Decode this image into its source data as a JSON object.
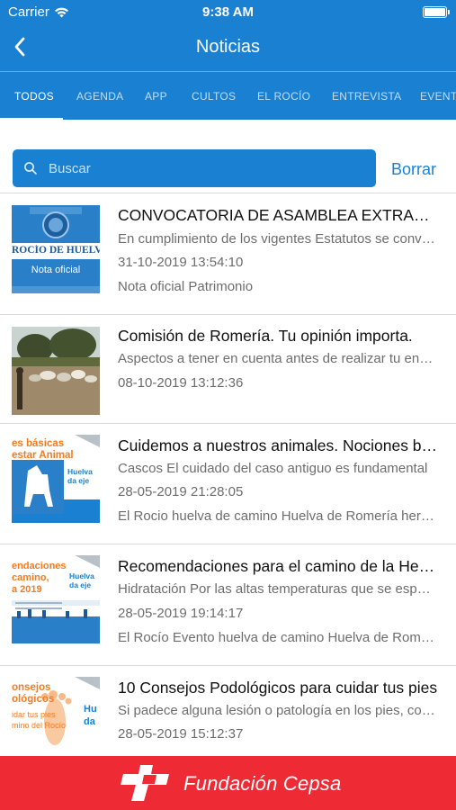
{
  "status_bar": {
    "carrier": "Carrier",
    "time": "9:38 AM",
    "battery_level": 1.0
  },
  "nav": {
    "title": "Noticias",
    "back_icon": "chevron-left-icon"
  },
  "tabs": [
    {
      "label": "TODOS",
      "active": true
    },
    {
      "label": "AGENDA"
    },
    {
      "label": "APP"
    },
    {
      "label": "CULTOS"
    },
    {
      "label": "EL ROCÍO"
    },
    {
      "label": "ENTREVISTA"
    },
    {
      "label": "EVENTO"
    }
  ],
  "search": {
    "placeholder": "Buscar",
    "value": "",
    "clear_label": "Borrar"
  },
  "news": [
    {
      "title": "CONVOCATORIA DE ASAMBLEA EXTRAORDINARIA",
      "summary": "En cumplimiento de los vigentes Estatutos se convoca",
      "date": "31-10-2019 13:54:10",
      "tags": "Nota oficial Patrimonio",
      "thumb": {
        "line1": "ROCÍO DE HUELVA",
        "line2": "Nota oficial"
      }
    },
    {
      "title": "Comisión de Romería. Tu opinión importa.",
      "summary": "Aspectos a tener en cuenta antes de realizar tu encuesta",
      "date": "08-10-2019 13:12:36",
      "tags": ""
    },
    {
      "title": "Cuidemos a nuestros animales. Nociones básicas",
      "summary": "Cascos El cuidado del caso antiguo es fundamental",
      "date": "28-05-2019 21:28:05",
      "tags": "El Rocio huelva de camino Huelva de Romería hermandad",
      "thumb": {
        "line1": "es básicas",
        "line2": "estar Animal",
        "line3": "Huelva",
        "line4": "da eje"
      }
    },
    {
      "title": "Recomendaciones para el camino de la Hermandad",
      "summary": "Hidratación Por las altas temperaturas que se esperan",
      "date": "28-05-2019 19:14:17",
      "tags": "El Rocío Evento huelva de camino Huelva de Romería",
      "thumb": {
        "line1": "endaciones",
        "line2": "camino,",
        "line3": "a 2019",
        "line4": "Huelva",
        "line5": "da eje"
      }
    },
    {
      "title": "10 Consejos Podológicos para cuidar tus pies",
      "summary": "Si padece alguna lesión o patología en los pies, consulte",
      "date": "28-05-2019 15:12:37",
      "tags": "",
      "thumb": {
        "line1": "onsejos",
        "line2": "ológicos",
        "line3": "idar tus pies",
        "line4": "mino del Rocío",
        "line5": "Hu",
        "line6": "da"
      }
    }
  ],
  "footer": {
    "brand": "Fundación Cepsa",
    "logo_icon": "cepsa-logo-icon"
  },
  "colors": {
    "primary": "#1a81d2",
    "footer": "#ee2a34",
    "thumb_orange": "#f47b20"
  }
}
